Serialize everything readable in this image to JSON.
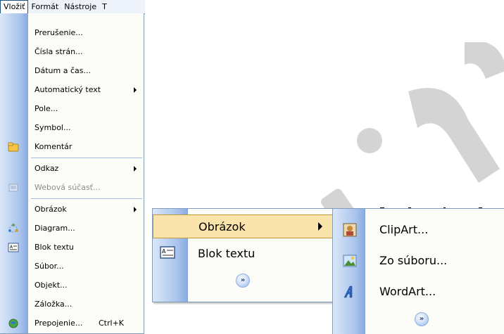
{
  "menubar": {
    "items": [
      {
        "label": "Vložiť"
      },
      {
        "label": "Formát"
      },
      {
        "label": "Nástroje"
      },
      {
        "label": "T"
      }
    ]
  },
  "insert_menu": {
    "items": [
      {
        "label": "Prerušenie..."
      },
      {
        "label": "Čísla strán..."
      },
      {
        "label": "Dátum a čas..."
      },
      {
        "label": "Automatický text"
      },
      {
        "label": "Pole..."
      },
      {
        "label": "Symbol..."
      },
      {
        "label": "Komentár"
      },
      {
        "label": "Odkaz"
      },
      {
        "label": "Webová súčasť..."
      },
      {
        "label": "Obrázok"
      },
      {
        "label": "Diagram..."
      },
      {
        "label": "Blok textu"
      },
      {
        "label": "Súbor..."
      },
      {
        "label": "Objekt..."
      },
      {
        "label": "Záložka..."
      },
      {
        "label": "Prepojenie...",
        "shortcut": "Ctrl+K"
      }
    ]
  },
  "short_menu": {
    "items": [
      {
        "label": "Obrázok"
      },
      {
        "label": "Blok textu"
      }
    ]
  },
  "picture_submenu": {
    "items": [
      {
        "label": "ClipArt..."
      },
      {
        "label": "Zo súboru..."
      },
      {
        "label": "WordArt..."
      }
    ]
  },
  "colors": {
    "gutter": "#a9c4ec",
    "highlight": "#fbe3ac",
    "border": "#7f9db9"
  }
}
